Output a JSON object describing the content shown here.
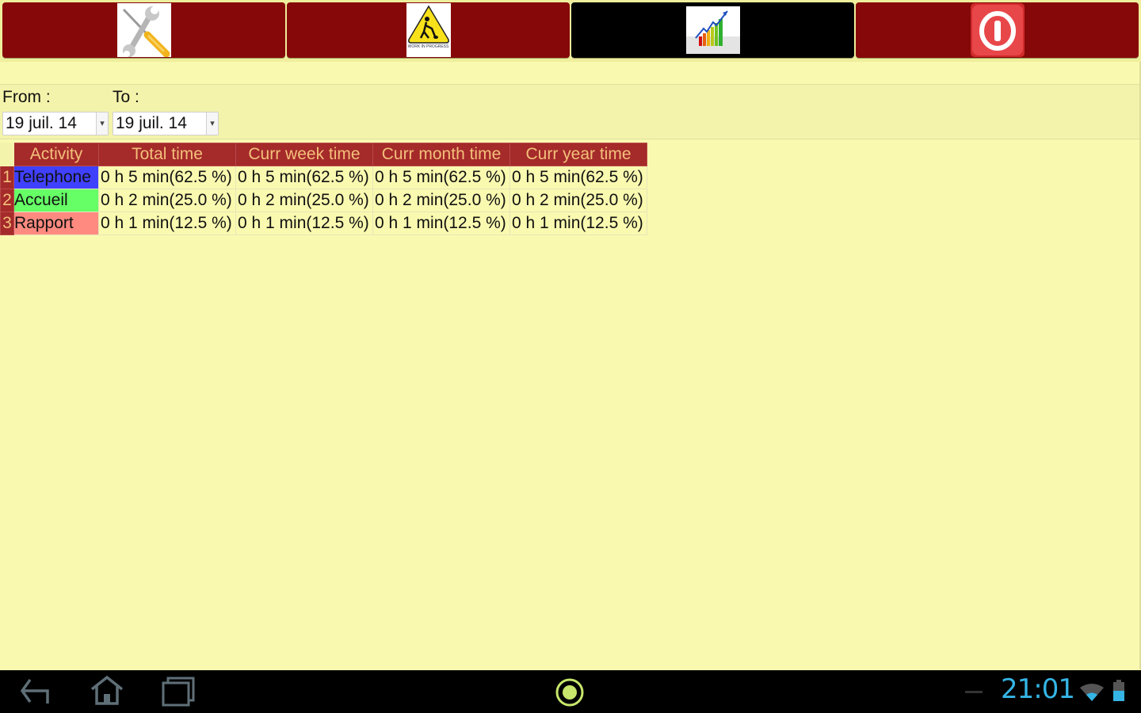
{
  "toolbar": {
    "buttons": [
      {
        "name": "settings",
        "icon": "tools-icon",
        "active": false
      },
      {
        "name": "work-in-progress",
        "icon": "work-in-progress-icon",
        "caption": "WORK IN PROGRESS",
        "active": false
      },
      {
        "name": "statistics",
        "icon": "growth-chart-icon",
        "active": true
      },
      {
        "name": "power",
        "icon": "power-icon",
        "active": false
      }
    ],
    "colors": {
      "button_bg": "#860808",
      "active_bg": "#000000"
    }
  },
  "filters": {
    "from_label": "From :",
    "to_label": "To :",
    "from_value": "19 juil. 14",
    "to_value": "19 juil. 14"
  },
  "table": {
    "headers": [
      "Activity",
      "Total time",
      "Curr week time",
      "Curr month time",
      "Curr year time"
    ],
    "rows": [
      {
        "index": "1",
        "activity": "Telephone",
        "color": "#4040ff",
        "total": "0 h 5 min(62.5 %)",
        "week": "0 h 5 min(62.5 %)",
        "month": "0 h 5 min(62.5 %)",
        "year": "0 h 5 min(62.5 %)"
      },
      {
        "index": "2",
        "activity": "Accueil",
        "color": "#66ff66",
        "total": "0 h 2 min(25.0 %)",
        "week": "0 h 2 min(25.0 %)",
        "month": "0 h 2 min(25.0 %)",
        "year": "0 h 2 min(25.0 %)"
      },
      {
        "index": "3",
        "activity": "Rapport",
        "color": "#ff8a80",
        "total": "0 h 1 min(12.5 %)",
        "week": "0 h 1 min(12.5 %)",
        "month": "0 h 1 min(12.5 %)",
        "year": "0 h 1 min(12.5 %)"
      }
    ]
  },
  "system_bar": {
    "time": "21:01",
    "icons": [
      "back-icon",
      "home-icon",
      "recent-apps-icon",
      "app-indicator-icon",
      "wifi-icon",
      "battery-icon"
    ]
  }
}
